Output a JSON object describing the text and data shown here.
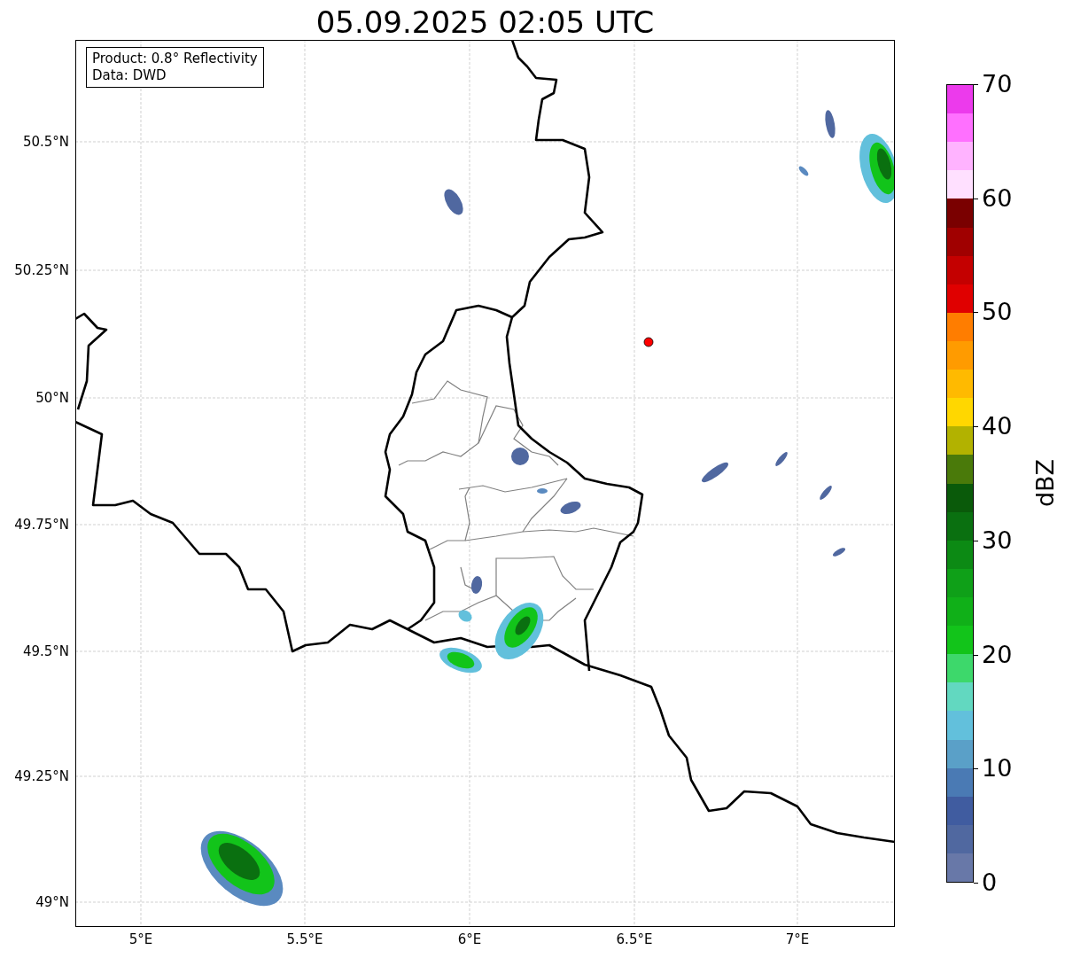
{
  "title": "05.09.2025 02:05 UTC",
  "info_box": [
    "Product: 0.8° Reflectivity",
    "Data: DWD"
  ],
  "map": {
    "y_ticks": [
      "50.5°N",
      "50.25°N",
      "50°N",
      "49.75°N",
      "49.5°N",
      "49.25°N",
      "49°N"
    ],
    "x_ticks": [
      "5°E",
      "5.5°E",
      "6°E",
      "6.5°E",
      "7°E"
    ]
  },
  "colorbar": {
    "label": "dBZ",
    "ticks": [
      "70",
      "60",
      "50",
      "40",
      "30",
      "20",
      "10",
      "0"
    ],
    "bins": [
      {
        "color": "#ec3aec"
      },
      {
        "color": "#ff70ff"
      },
      {
        "color": "#ffb3ff"
      },
      {
        "color": "#ffe0ff"
      },
      {
        "color": "#7a0000"
      },
      {
        "color": "#a00000"
      },
      {
        "color": "#c40000"
      },
      {
        "color": "#e00000"
      },
      {
        "color": "#ff7d00"
      },
      {
        "color": "#ff9b00"
      },
      {
        "color": "#ffba00"
      },
      {
        "color": "#ffd700"
      },
      {
        "color": "#b2b200"
      },
      {
        "color": "#4a7a0a"
      },
      {
        "color": "#0a5a0a"
      },
      {
        "color": "#0a7010"
      },
      {
        "color": "#0c8a14"
      },
      {
        "color": "#0fa018"
      },
      {
        "color": "#10b018"
      },
      {
        "color": "#12c41a"
      },
      {
        "color": "#3dd86b"
      },
      {
        "color": "#62d8c0"
      },
      {
        "color": "#62c0dc"
      },
      {
        "color": "#5aa0c8"
      },
      {
        "color": "#4a7ab4"
      },
      {
        "color": "#405ca0"
      },
      {
        "color": "#5068a0"
      },
      {
        "color": "#6878a8"
      }
    ]
  }
}
